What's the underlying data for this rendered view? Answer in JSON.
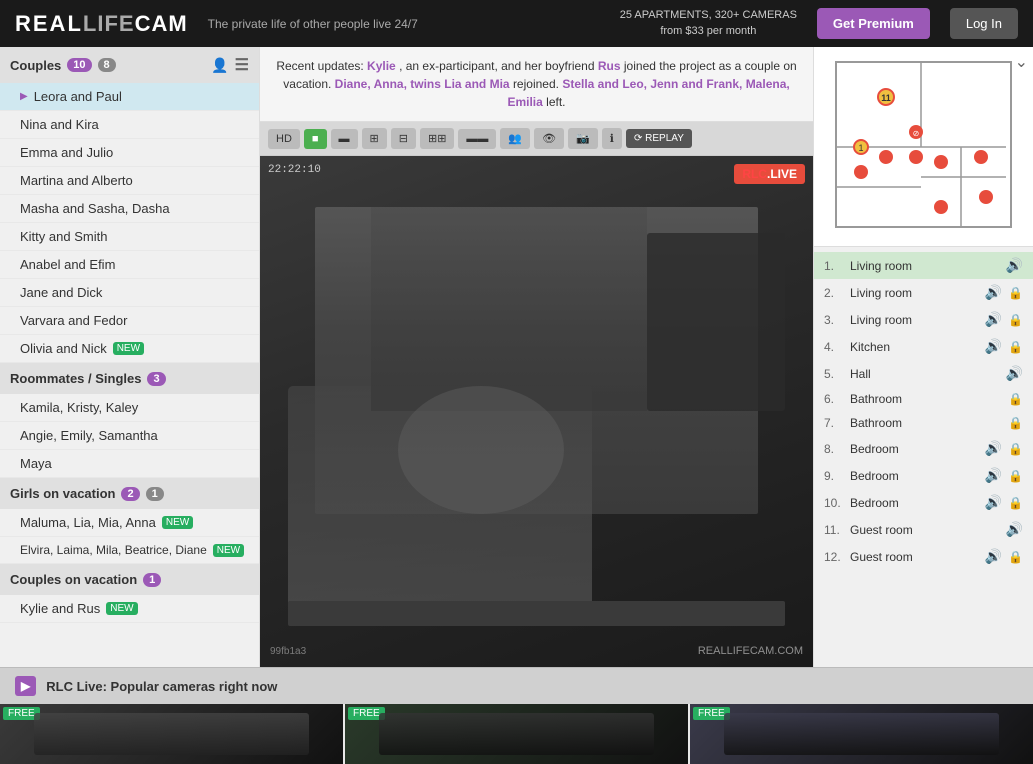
{
  "header": {
    "logo": "REALLIFECAM",
    "tagline": "The private life of other people live 24/7",
    "stats_line1": "25 APARTMENTS, 320+ CAMERAS",
    "stats_line2": "from $33 per month",
    "btn_premium": "Get Premium",
    "btn_login": "Log In"
  },
  "sidebar": {
    "couples_label": "Couples",
    "couples_count1": "10",
    "couples_count2": "8",
    "couples": [
      {
        "name": "Leora and Paul",
        "active": true
      },
      {
        "name": "Nina and Kira"
      },
      {
        "name": "Emma and Julio"
      },
      {
        "name": "Martina and Alberto"
      },
      {
        "name": "Masha and Sasha, Dasha"
      },
      {
        "name": "Kitty and Smith"
      },
      {
        "name": "Anabel and Efim"
      },
      {
        "name": "Jane and Dick"
      },
      {
        "name": "Varvara and Fedor"
      },
      {
        "name": "Olivia and Nick",
        "badge_new": true
      }
    ],
    "roommates_label": "Roommates / Singles",
    "roommates_count": "3",
    "roommates": [
      {
        "name": "Kamila, Kristy, Kaley"
      },
      {
        "name": "Angie, Emily, Samantha"
      },
      {
        "name": "Maya"
      }
    ],
    "girls_label": "Girls on vacation",
    "girls_count1": "2",
    "girls_count2": "1",
    "girls": [
      {
        "name": "Maluma, Lia, Mia, Anna",
        "badge_new": true
      },
      {
        "name": "Elvira, Laima, Mila, Beatrice, Diane",
        "badge_new": true
      }
    ],
    "couples_vacation_label": "Couples on vacation",
    "couples_vacation_count": "1",
    "couples_vacation": [
      {
        "name": "Kylie and Rus",
        "badge_new": true
      }
    ]
  },
  "notification": {
    "text": "Recent updates: Kylie, an ex-participant, and her boyfriend Rus joined the project as a couple on vacation. Diane, Anna, twins Lia and Mia rejoined. Stella and Leo, Jenn and Frank, Malena, Emilia left.",
    "highlights": [
      "Kylie",
      "Rus",
      "Diane, Anna, twins Lia and Mia",
      "Stella and Leo, Jenn and Frank, Malena, Emilia"
    ]
  },
  "video": {
    "timestamp": "22:22:10",
    "live_badge": "RLC.LIVE",
    "watermark": "REALLIFECAM.COM",
    "video_id": "99fb1a3"
  },
  "rooms": [
    {
      "num": "1.",
      "name": "Living room",
      "sound": true,
      "lock": false,
      "active": true
    },
    {
      "num": "2.",
      "name": "Living room",
      "sound": true,
      "lock": true
    },
    {
      "num": "3.",
      "name": "Living room",
      "sound": true,
      "lock": true
    },
    {
      "num": "4.",
      "name": "Kitchen",
      "sound": true,
      "lock": true
    },
    {
      "num": "5.",
      "name": "Hall",
      "sound": true,
      "lock": false
    },
    {
      "num": "6.",
      "name": "Bathroom",
      "sound": false,
      "lock": true
    },
    {
      "num": "7.",
      "name": "Bathroom",
      "sound": false,
      "lock": true
    },
    {
      "num": "8.",
      "name": "Bedroom",
      "sound": true,
      "lock": true
    },
    {
      "num": "9.",
      "name": "Bedroom",
      "sound": true,
      "lock": true
    },
    {
      "num": "10.",
      "name": "Bedroom",
      "sound": true,
      "lock": true
    },
    {
      "num": "11.",
      "name": "Guest room",
      "sound": true,
      "lock": false
    },
    {
      "num": "12.",
      "name": "Guest room",
      "sound": true,
      "lock": true
    }
  ],
  "bottom_bar": {
    "icon": "▶",
    "label": "RLC Live: Popular cameras right now"
  },
  "thumbnails": [
    {
      "label": "FREE",
      "bg": "1"
    },
    {
      "label": "FREE",
      "bg": "2"
    },
    {
      "label": "FREE",
      "bg": "3"
    }
  ]
}
